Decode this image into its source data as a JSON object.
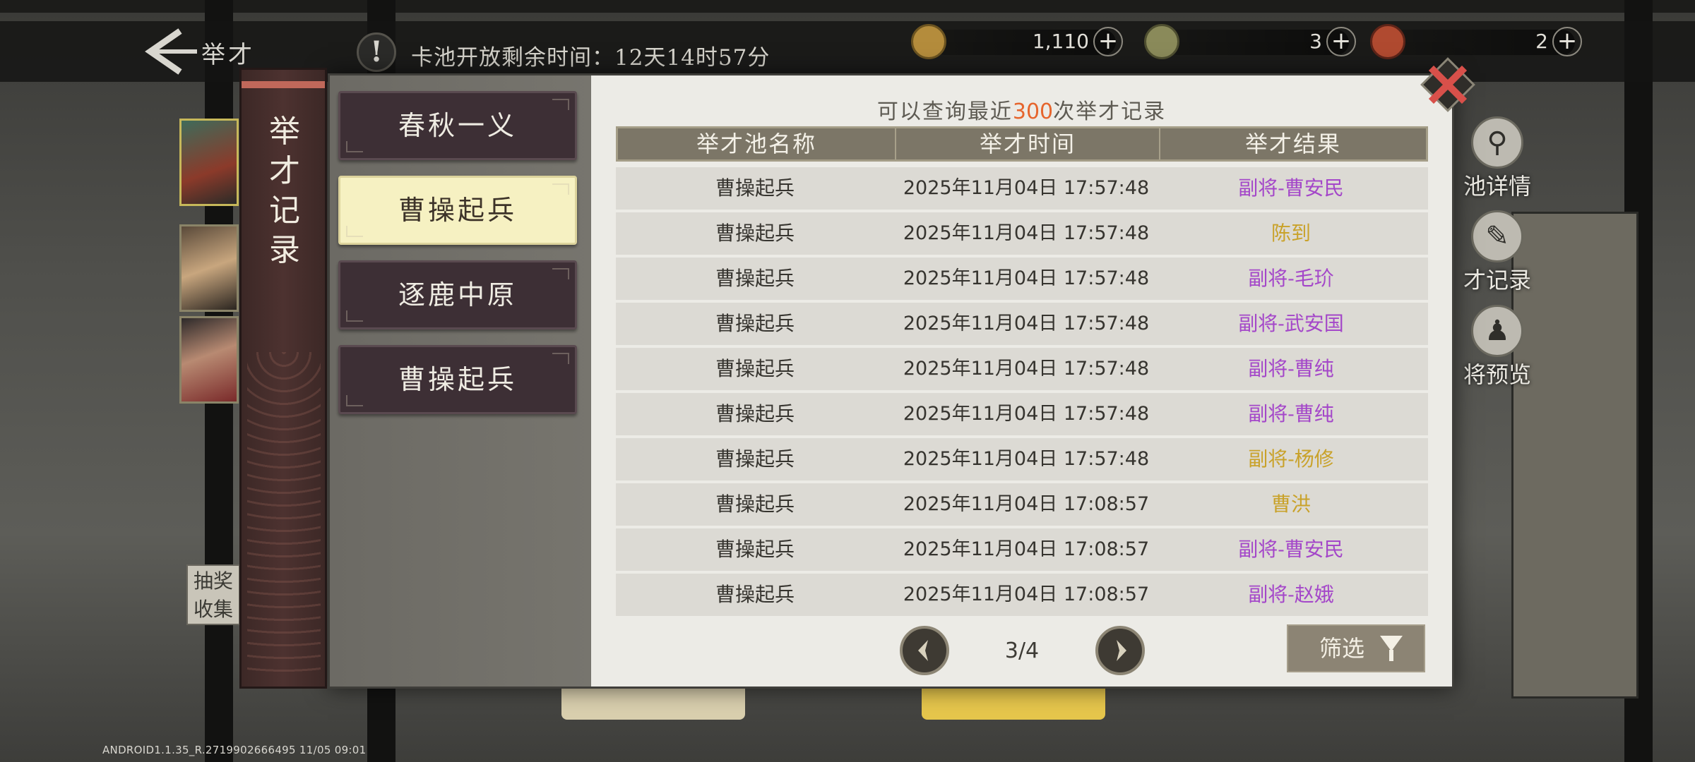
{
  "header": {
    "title": "举才",
    "pool_timer": "卡池开放剩余时间：12天14时57分",
    "currencies": [
      {
        "icon": "coin-icon",
        "value": "1,110",
        "color": "#b48c3c"
      },
      {
        "icon": "jade-token-icon",
        "value": "3",
        "color": "#8a8a5a"
      },
      {
        "icon": "seal-token-icon",
        "value": "2",
        "color": "#b04a30"
      }
    ]
  },
  "side_features": [
    {
      "label": "池详情",
      "icon": "magnifier-icon"
    },
    {
      "label": "才记录",
      "icon": "scroll-record-icon"
    },
    {
      "label": "将预览",
      "icon": "general-preview-icon"
    }
  ],
  "lottery_box": {
    "line1": "抽奖",
    "line2": "收集"
  },
  "version": "ANDROID1.1.35_R.2719902666495 11/05 09:01",
  "dialog": {
    "banner_title": [
      "举",
      "才",
      "记",
      "录"
    ],
    "pools": [
      "春秋一义",
      "曹操起兵",
      "逐鹿中原",
      "曹操起兵"
    ],
    "active_pool_index": 1,
    "hint_prefix": "可以查询最近",
    "hint_number": "300",
    "hint_suffix": "次举才记录",
    "columns": [
      "举才池名称",
      "举才时间",
      "举才结果"
    ],
    "rows": [
      {
        "pool": "曹操起兵",
        "time": "2025年11月04日 17:57:48",
        "result": "副将-曹安民",
        "color": "#a447c9"
      },
      {
        "pool": "曹操起兵",
        "time": "2025年11月04日 17:57:48",
        "result": "陈到",
        "color": "#c9a22a"
      },
      {
        "pool": "曹操起兵",
        "time": "2025年11月04日 17:57:48",
        "result": "副将-毛玠",
        "color": "#a447c9"
      },
      {
        "pool": "曹操起兵",
        "time": "2025年11月04日 17:57:48",
        "result": "副将-武安国",
        "color": "#a447c9"
      },
      {
        "pool": "曹操起兵",
        "time": "2025年11月04日 17:57:48",
        "result": "副将-曹纯",
        "color": "#a447c9"
      },
      {
        "pool": "曹操起兵",
        "time": "2025年11月04日 17:57:48",
        "result": "副将-曹纯",
        "color": "#a447c9"
      },
      {
        "pool": "曹操起兵",
        "time": "2025年11月04日 17:57:48",
        "result": "副将-杨修",
        "color": "#c9a22a"
      },
      {
        "pool": "曹操起兵",
        "time": "2025年11月04日 17:08:57",
        "result": "曹洪",
        "color": "#c9a22a"
      },
      {
        "pool": "曹操起兵",
        "time": "2025年11月04日 17:08:57",
        "result": "副将-曹安民",
        "color": "#a447c9"
      },
      {
        "pool": "曹操起兵",
        "time": "2025年11月04日 17:08:57",
        "result": "副将-赵娥",
        "color": "#a447c9"
      }
    ],
    "page_indicator": "3/4",
    "filter_label": "筛选"
  }
}
